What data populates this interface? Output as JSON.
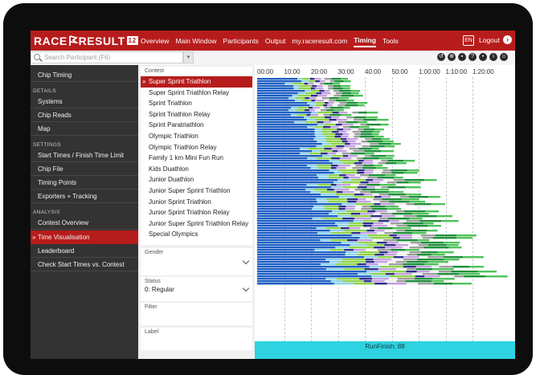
{
  "app": {
    "logo_left": "RACE",
    "logo_right": "RESULT",
    "logo_version": "12"
  },
  "nav": {
    "items": [
      {
        "label": "Overview",
        "active": false
      },
      {
        "label": "Main Window",
        "active": false
      },
      {
        "label": "Participants",
        "active": false
      },
      {
        "label": "Output",
        "active": false
      },
      {
        "label": "my.raceresult.com",
        "active": false
      },
      {
        "label": "Timing",
        "active": true
      },
      {
        "label": "Tools",
        "active": false
      }
    ],
    "language": "EN",
    "logout_label": "Logout"
  },
  "search": {
    "placeholder": "Search Participant (F6)"
  },
  "toolbar_icons": [
    "history-icon",
    "target-icon",
    "chat-icon",
    "help-icon",
    "bulb-icon",
    "info-icon",
    "users-icon"
  ],
  "sidebar": {
    "top_item": "Chip Timing",
    "details_header": "DETAILS",
    "details_items": [
      "Systems",
      "Chip Reads",
      "Map"
    ],
    "settings_header": "SETTINGS",
    "settings_items": [
      "Start Times / Finish Time Limit",
      "Chip File",
      "Timing Points",
      "Exporters + Tracking"
    ],
    "analysis_header": "ANALYSIS",
    "analysis_items": [
      "Contest Overview",
      "Time Visualisation",
      "Leaderboard",
      "Check Start Times vs. Contest"
    ],
    "active_item": "Time Visualisation"
  },
  "filters": {
    "contest_label": "Contest",
    "contests": [
      "Super Sprint Triathlon",
      "Super Sprint Triathlon Relay",
      "Sprint Triathlon",
      "Sprint Triathlon Relay",
      "Sprint Paratriathlon",
      "Olympic Triathlon",
      "Olympic Triathlon Relay",
      "Family 1 km Mini Fun Run",
      "Kids Duathlon",
      "Junior Duathlon",
      "Junior Super Sprint Triathlon",
      "Junior Sprint Triathlon",
      "Junior Sprint Triathlon Relay",
      "Junior Super Sprint Triathlon Relay",
      "Special Olympics"
    ],
    "selected_contest": "Super Sprint Triathlon",
    "gender_label": "Gender",
    "gender_value": "",
    "status_label": "Status",
    "status_value": "0: Regular",
    "filter_label": "Filter",
    "label_label": "Label"
  },
  "chart_data": {
    "type": "bar",
    "x_ticks": [
      "00:00",
      "10:00",
      "20:00",
      "30:00",
      "40:00",
      "50:00",
      "1:00:00",
      "1:10:00",
      "1:20:00"
    ],
    "x_range_minutes": [
      0,
      90
    ],
    "grid": true,
    "segment_colors": [
      "#1f5fc4",
      "#8fd3ec",
      "#8fd34b",
      "#2f2f8c",
      "#c4a0e0",
      "#f0f0f0",
      "#9e9e9e",
      "#1f8f3a",
      "#4fc35a"
    ],
    "finish_label": "RunFinish: 88"
  }
}
